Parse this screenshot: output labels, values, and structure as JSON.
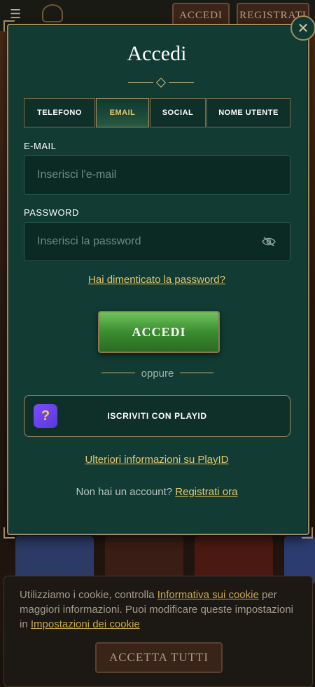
{
  "header": {
    "login_label": "ACCEDI",
    "register_label": "REGISTRATI"
  },
  "modal": {
    "title": "Accedi",
    "tabs": [
      {
        "label": "TELEFONO",
        "active": false
      },
      {
        "label": "EMAIL",
        "active": true
      },
      {
        "label": "SOCIAL",
        "active": false
      },
      {
        "label": "NOME UTENTE",
        "active": false
      }
    ],
    "email_label": "E-MAIL",
    "email_placeholder": "Inserisci l'e-mail",
    "password_label": "PASSWORD",
    "password_placeholder": "Inserisci la password",
    "forgot_link": "Hai dimenticato la password?",
    "login_button": "ACCEDI",
    "or_text": "oppure",
    "playid_button": "ISCRIVITI CON PLAYID",
    "playid_info": "Ulteriori informazioni su PlayID",
    "no_account_text": "Non hai un account?",
    "signup_link": "Registrati ora"
  },
  "cookie": {
    "text_1": "Utilizziamo i cookie, controlla ",
    "link_1": "Informativa sui cookie",
    "text_2": " per maggiori informazioni. Puoi modificare queste impostazioni in ",
    "link_2": "Impostazioni dei cookie",
    "accept_button": "ACCETTA TUTTI"
  },
  "colors": {
    "modal_bg": "#113b33",
    "accent_gold": "#e6c86a",
    "login_green": "#3b8d31"
  }
}
